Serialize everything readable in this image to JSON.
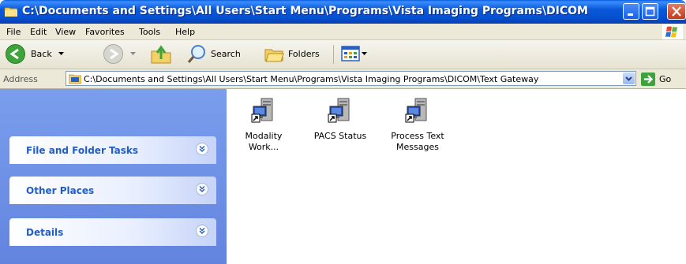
{
  "window": {
    "title": "C:\\Documents and Settings\\All Users\\Start Menu\\Programs\\Vista Imaging Programs\\DICOM..."
  },
  "menu": [
    "File",
    "Edit",
    "View",
    "Favorites",
    "Tools",
    "Help"
  ],
  "toolbar": {
    "back_label": "Back",
    "search_label": "Search",
    "folders_label": "Folders"
  },
  "address": {
    "label": "Address",
    "value": "C:\\Documents and Settings\\All Users\\Start Menu\\Programs\\Vista Imaging Programs\\DICOM\\Text Gateway",
    "go_label": "Go"
  },
  "tasks": [
    {
      "title": "File and Folder Tasks"
    },
    {
      "title": "Other Places"
    },
    {
      "title": "Details"
    }
  ],
  "files": [
    {
      "line1": "Modality",
      "line2": "Work..."
    },
    {
      "line1": "PACS Status",
      "line2": ""
    },
    {
      "line1": "Process Text",
      "line2": "Messages"
    }
  ],
  "colors": {
    "titlebar": "#0a58d8",
    "taskpane": "#6c8fe5",
    "task_title": "#215dc6"
  }
}
